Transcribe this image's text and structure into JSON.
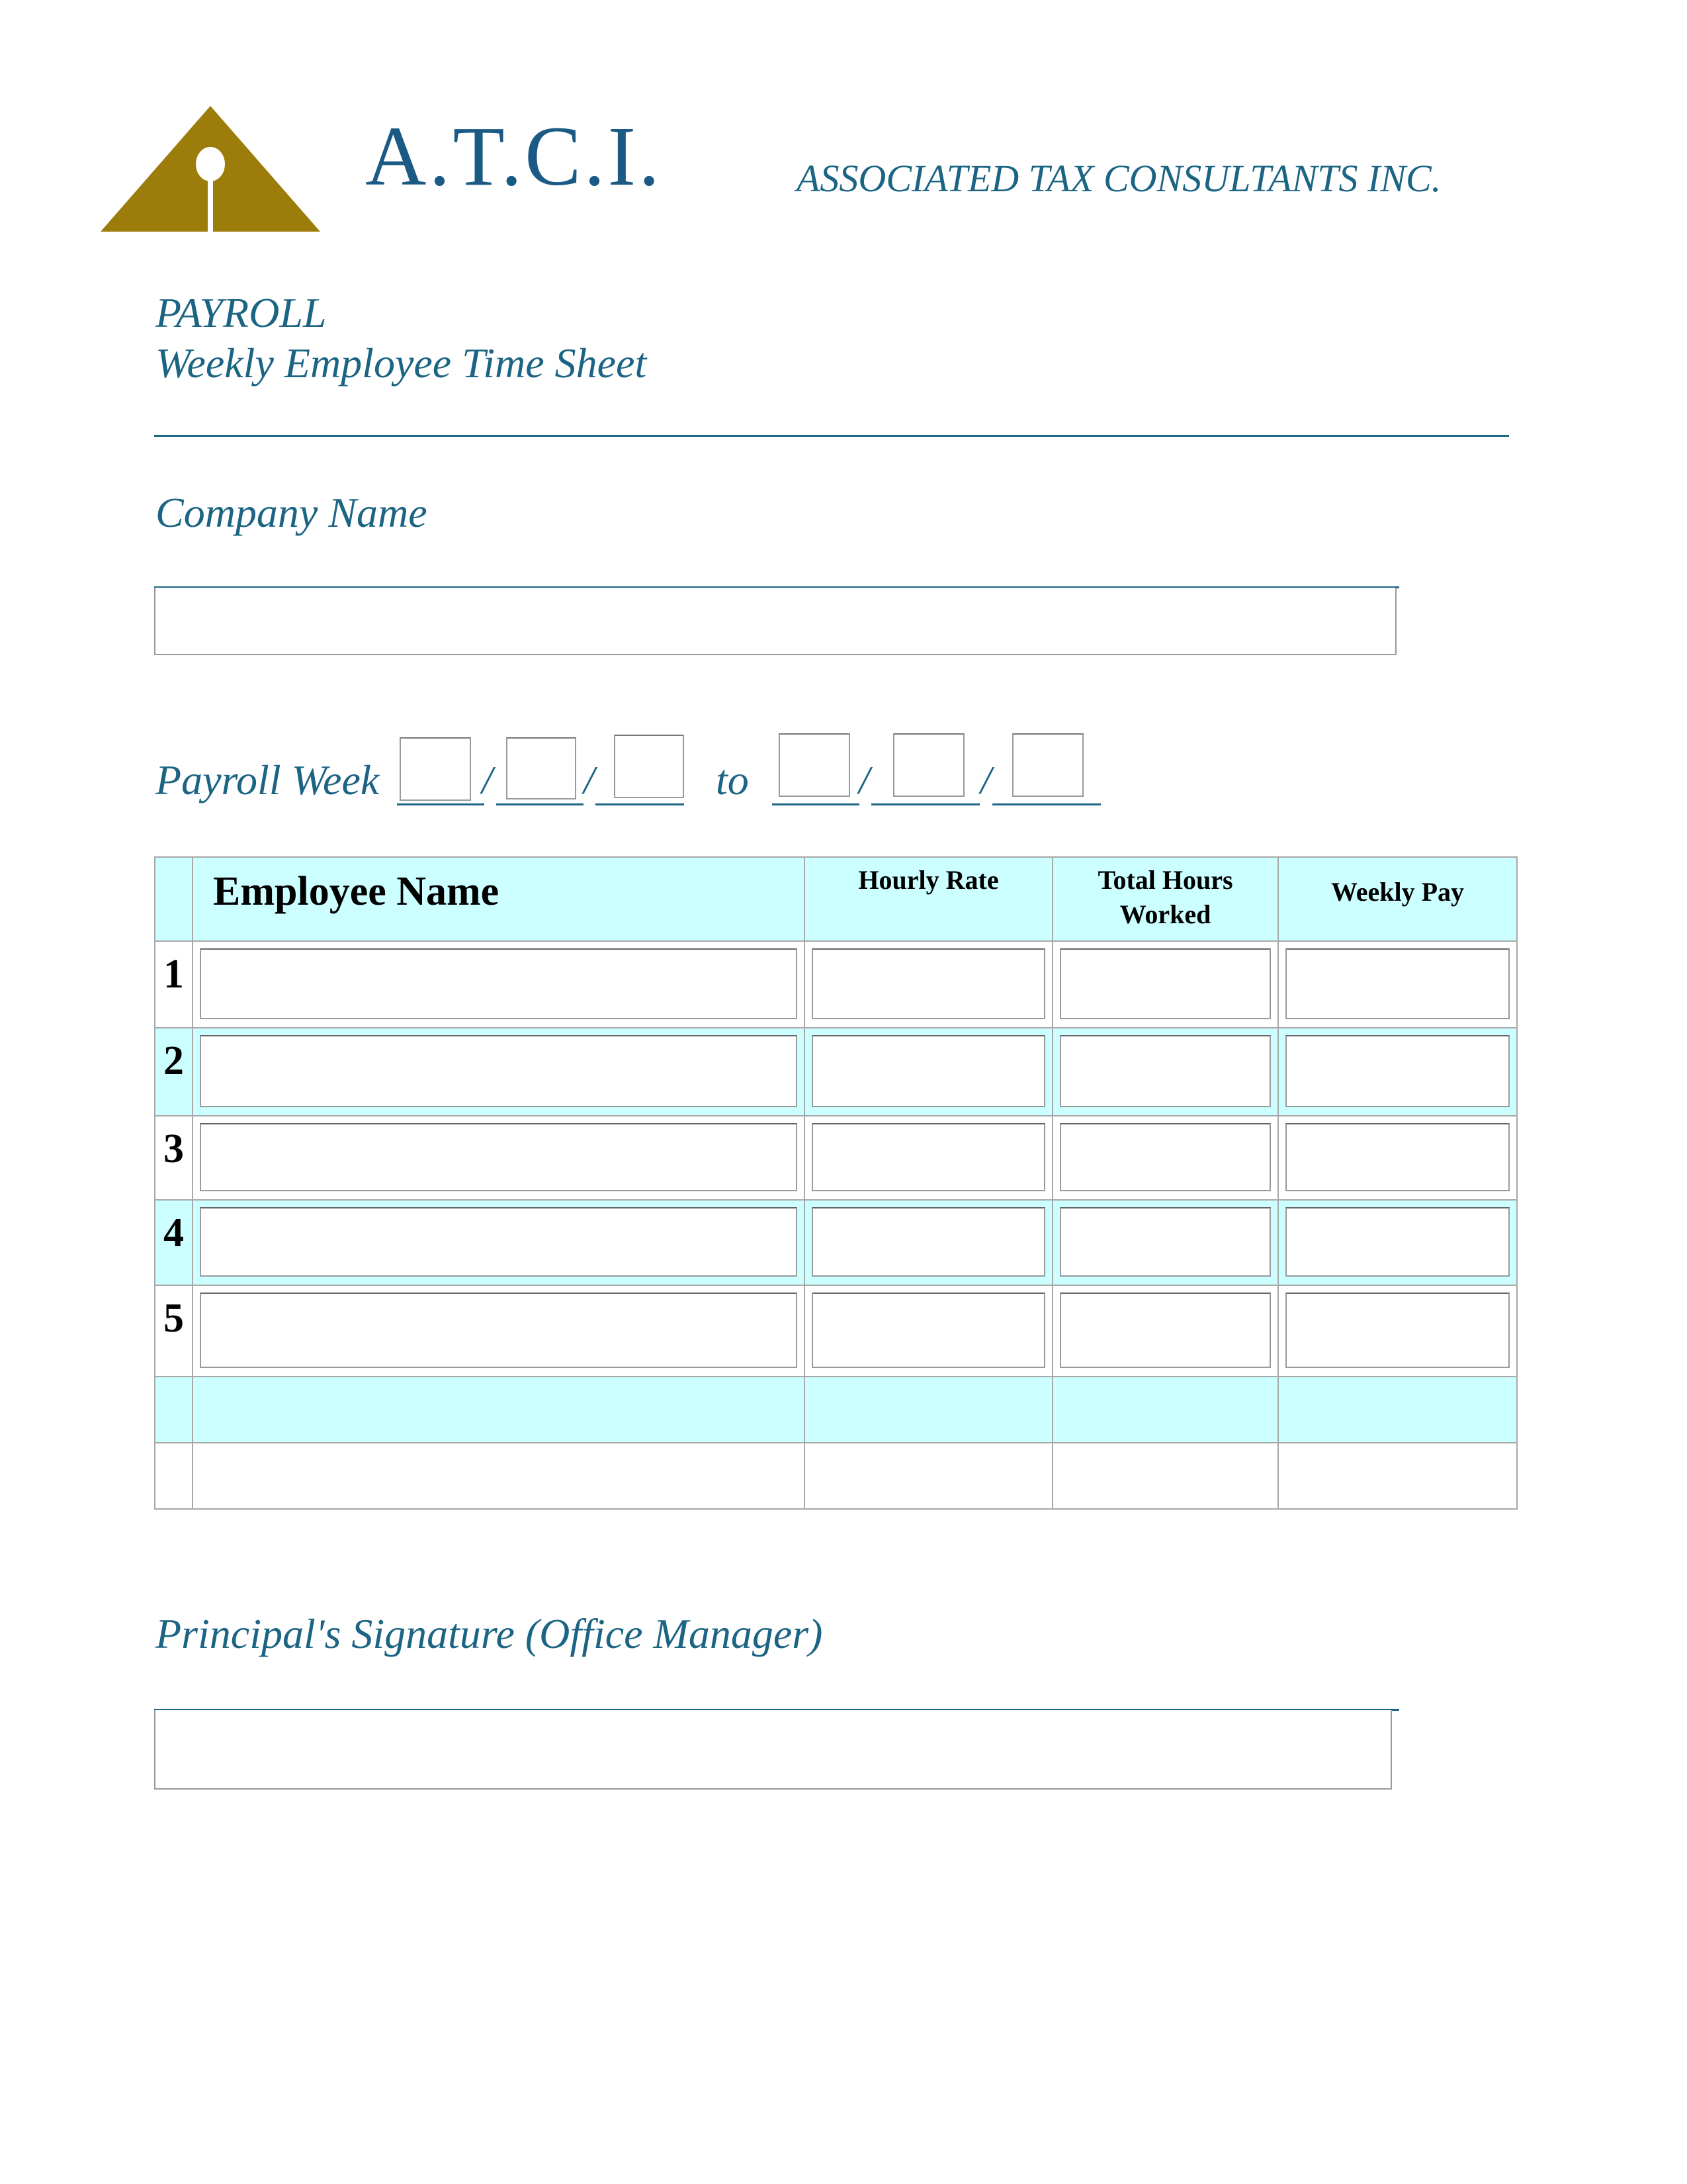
{
  "header": {
    "logo_text": "A.T.C.I.",
    "company_full_name": "ASSOCIATED TAX CONSULTANTS INC.",
    "logo_color": "#9c7d0c",
    "brand_color": "#1b5a85"
  },
  "title": {
    "line1": "PAYROLL",
    "line2": "Weekly Employee Time Sheet"
  },
  "company": {
    "label": "Company Name",
    "value": ""
  },
  "payroll_week": {
    "label": "Payroll Week",
    "separator": "/",
    "to_label": "to",
    "from": [
      "",
      "",
      ""
    ],
    "to": [
      "",
      "",
      ""
    ]
  },
  "table": {
    "columns": [
      "Employee Name",
      "Hourly Rate",
      "Total Hours Worked",
      "Weekly Pay"
    ],
    "rows": [
      {
        "num": "1",
        "name": "",
        "rate": "",
        "hours": "",
        "pay": ""
      },
      {
        "num": "2",
        "name": "",
        "rate": "",
        "hours": "",
        "pay": ""
      },
      {
        "num": "3",
        "name": "",
        "rate": "",
        "hours": "",
        "pay": ""
      },
      {
        "num": "4",
        "name": "",
        "rate": "",
        "hours": "",
        "pay": ""
      },
      {
        "num": "5",
        "name": "",
        "rate": "",
        "hours": "",
        "pay": ""
      }
    ],
    "header_color": "#ccffff"
  },
  "signature": {
    "label": "Principal's Signature (Office Manager)",
    "value": ""
  }
}
